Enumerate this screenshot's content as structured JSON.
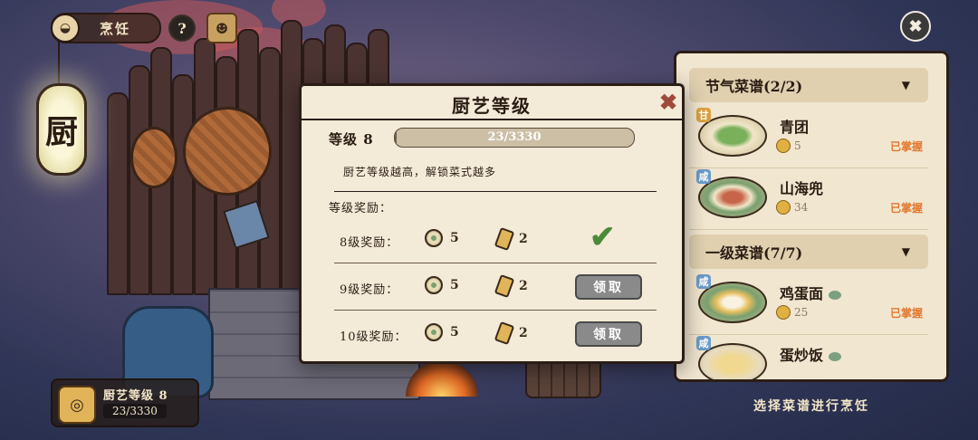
{
  "hud": {
    "title": "烹饪",
    "help": "?",
    "close": "✖",
    "bowl_icon": "bowl-icon",
    "chef_icon": "chef-avatar-icon"
  },
  "lantern": {
    "char": "厨"
  },
  "level_card": {
    "label": "厨艺等级 8",
    "value": "23/3330"
  },
  "dialog": {
    "title": "厨艺等级",
    "close": "✖",
    "level_label": "等级 8",
    "progress_text": "23/3330",
    "progress_fraction": 0.0069,
    "description": "厨艺等级越高，解锁菜式越多",
    "rewards_heading": "等级奖励：",
    "rewards": [
      {
        "label": "8级奖励：",
        "item1_count": "5",
        "item2_count": "2",
        "status": "claimed",
        "button": ""
      },
      {
        "label": "9级奖励：",
        "item1_count": "5",
        "item2_count": "2",
        "status": "locked",
        "button": "领取"
      },
      {
        "label": "10级奖励：",
        "item1_count": "5",
        "item2_count": "2",
        "status": "locked",
        "button": "领取"
      }
    ]
  },
  "recipe_panel": {
    "sections": [
      {
        "title": "节气菜谱(2/2)",
        "items": [
          {
            "tag": "甘",
            "tag_color": "#d9a040",
            "name": "青团",
            "cost": "5",
            "status": "已掌握"
          },
          {
            "tag": "咸",
            "tag_color": "#6a9ac8",
            "name": "山海兜",
            "cost": "34",
            "status": "已掌握"
          }
        ]
      },
      {
        "title": "一级菜谱(7/7)",
        "items": [
          {
            "tag": "咸",
            "tag_color": "#6a9ac8",
            "name": "鸡蛋面",
            "cost": "25",
            "status": "已掌握"
          },
          {
            "tag": "咸",
            "tag_color": "#6a9ac8",
            "name": "蛋炒饭",
            "cost": "",
            "status": ""
          }
        ]
      }
    ],
    "hint": "选择菜谱进行烹饪"
  }
}
